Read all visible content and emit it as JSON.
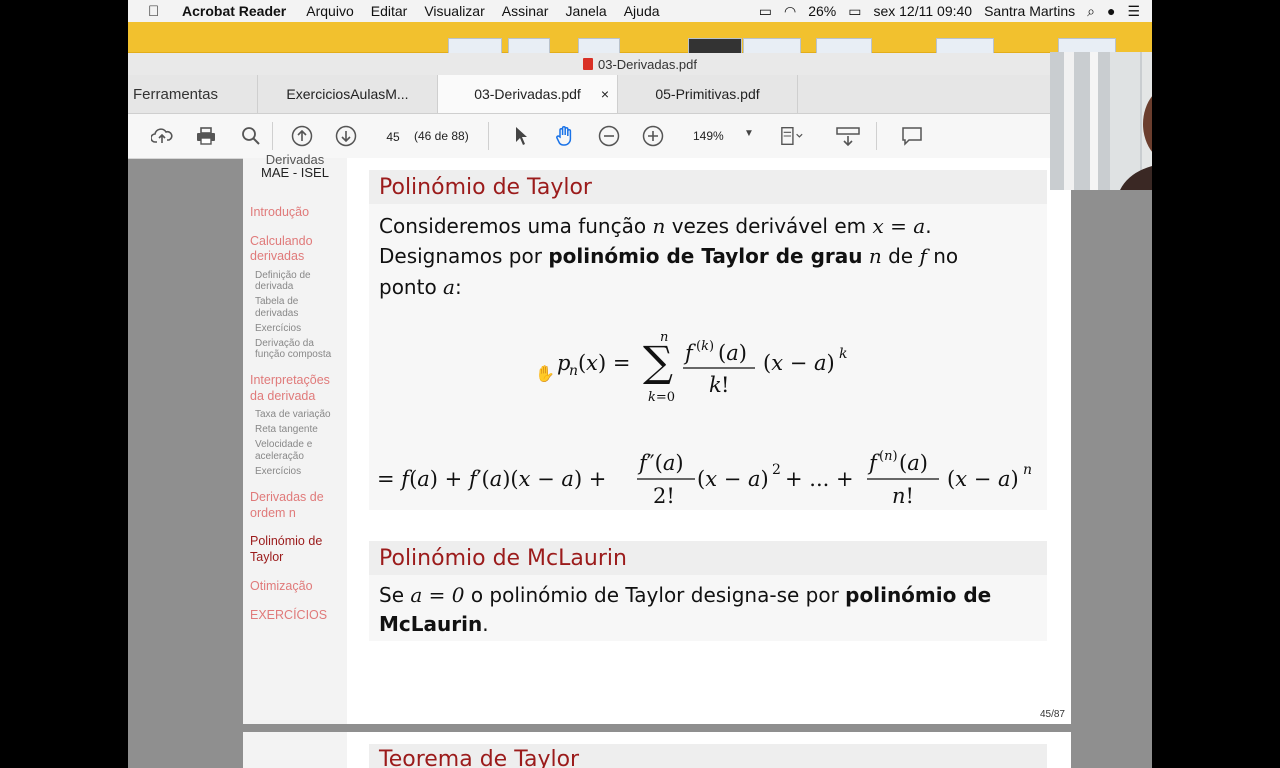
{
  "menubar": {
    "app": "Acrobat Reader",
    "items": [
      "Arquivo",
      "Editar",
      "Visualizar",
      "Assinar",
      "Janela",
      "Ajuda"
    ],
    "battery": "26%",
    "datetime": "sex 12/11  09:40",
    "user": "Santra Martins"
  },
  "window": {
    "title": "03-Derivadas.pdf"
  },
  "tabs": {
    "tools": "Ferramentas",
    "items": [
      "ExerciciosAulasM...",
      "03-Derivadas.pdf",
      "05-Primitivas.pdf"
    ],
    "close": "×"
  },
  "toolbar": {
    "page_value": "45",
    "page_of": "(46 de 88)",
    "zoom": "149%"
  },
  "nav": {
    "header1": "Derivadas",
    "header2": "MAE - ISEL",
    "sections": {
      "intro": "Introdução",
      "calc1": "Calculando",
      "calc2": "derivadas",
      "def1": "Definição de",
      "def2": "derivada",
      "tab1": "Tabela de",
      "tab2": "derivadas",
      "ex1": "Exercícios",
      "comp1": "Derivação da",
      "comp2": "função composta",
      "interp1": "Interpretações",
      "interp2": "da derivada",
      "taxa": "Taxa de variação",
      "reta": "Reta tangente",
      "vel1": "Velocidade e",
      "vel2": "aceleração",
      "ex2": "Exercícios",
      "ordem1": "Derivadas de",
      "ordem2": "ordem n",
      "taylor1": "Polinómio de",
      "taylor2": "Taylor",
      "otim": "Otimização",
      "exerc": "EXERCÍCIOS"
    }
  },
  "slide": {
    "title1": "Polinómio de Taylor",
    "p1_a": "Consideremos uma função ",
    "p1_n": "n",
    "p1_b": " vezes derivável em ",
    "p1_eq": "x = a",
    "p1_c": ".",
    "p2_a": "Designamos por ",
    "p2_bold": "polinómio de Taylor de grau",
    "p2_n": "n",
    "p2_b": " de ",
    "p2_f": "f",
    "p2_c": " no",
    "p3_a": "ponto ",
    "p3_var": "a",
    "p3_b": ":",
    "title2": "Polinómio de McLaurin",
    "q1_a": "Se ",
    "q1_eq": "a = 0",
    "q1_b": " o polinómio de Taylor designa-se por ",
    "q1_bold": "polinómio de",
    "q2_bold": "McLaurin",
    "q2_b": ".",
    "page_number": "45/87",
    "next_title": "Teorema de Taylor"
  }
}
